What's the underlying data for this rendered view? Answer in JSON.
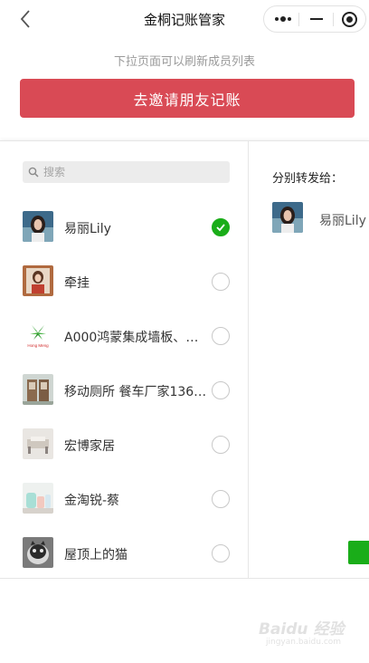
{
  "header": {
    "title": "金桐记账管家",
    "back_icon": "chevron-left-icon",
    "capsule_icons": [
      "more-dots-icon",
      "minimize-icon",
      "target-icon"
    ]
  },
  "hint_text": "下拉页面可以刷新成员列表",
  "invite_button_label": "去邀请朋友记账",
  "search": {
    "placeholder": "搜索",
    "value": ""
  },
  "members": [
    {
      "name": "易丽Lily",
      "selected": true
    },
    {
      "name": "牵挂",
      "selected": false
    },
    {
      "name": "A000鸿蒙集成墙板、地…",
      "selected": false
    },
    {
      "name": "移动厕所 餐车厂家1367…",
      "selected": false
    },
    {
      "name": "宏博家居",
      "selected": false
    },
    {
      "name": "金淘锐-蔡",
      "selected": false
    },
    {
      "name": "屋顶上的猫",
      "selected": false
    }
  ],
  "avatar3_text": "Hong Meng",
  "forward": {
    "label": "分别转发给：",
    "selected_name": "易丽Lily"
  },
  "colors": {
    "invite_red": "#d94a55",
    "check_green": "#1aad19"
  },
  "watermark": {
    "brand": "Baidu 经验",
    "sub": "jingyan.baidu.com"
  }
}
